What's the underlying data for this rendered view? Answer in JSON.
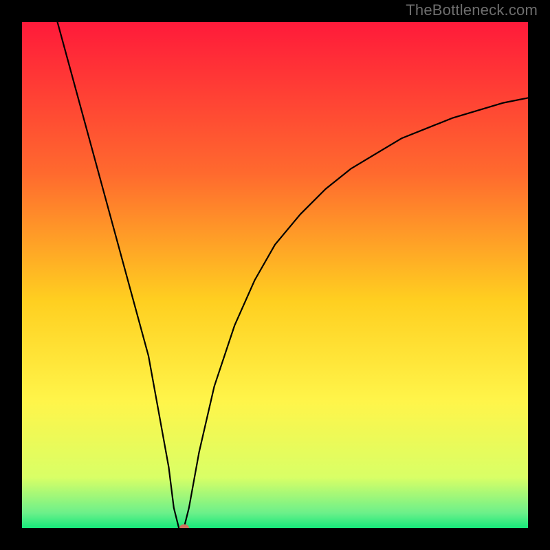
{
  "watermark": "TheBottleneck.com",
  "chart_data": {
    "type": "line",
    "title": "",
    "xlabel": "",
    "ylabel": "",
    "xlim": [
      0,
      100
    ],
    "ylim": [
      0,
      100
    ],
    "series": [
      {
        "name": "bottleneck-curve",
        "x": [
          7,
          10,
          13,
          16,
          19,
          22,
          25,
          27,
          29,
          30,
          31,
          32,
          33,
          35,
          38,
          42,
          46,
          50,
          55,
          60,
          65,
          70,
          75,
          80,
          85,
          90,
          95,
          100
        ],
        "values": [
          100,
          89,
          78,
          67,
          56,
          45,
          34,
          23,
          12,
          4,
          0,
          0,
          4,
          15,
          28,
          40,
          49,
          56,
          62,
          67,
          71,
          74,
          77,
          79,
          81,
          82.5,
          84,
          85
        ]
      }
    ],
    "marker": {
      "x": 32,
      "y": 0
    },
    "gradient_stops": [
      {
        "pos": 0.0,
        "color": "#ff1a3a"
      },
      {
        "pos": 0.3,
        "color": "#ff6a2e"
      },
      {
        "pos": 0.55,
        "color": "#ffcf20"
      },
      {
        "pos": 0.75,
        "color": "#fff54a"
      },
      {
        "pos": 0.9,
        "color": "#d9ff66"
      },
      {
        "pos": 0.97,
        "color": "#6cf08a"
      },
      {
        "pos": 1.0,
        "color": "#17e87a"
      }
    ]
  }
}
